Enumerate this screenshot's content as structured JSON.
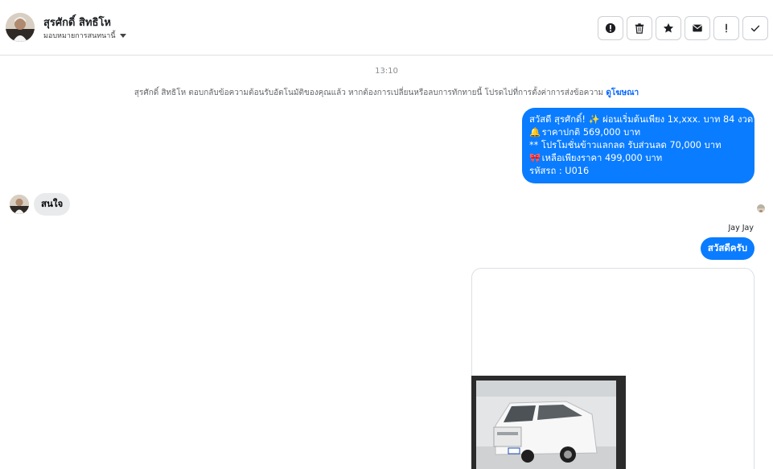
{
  "header": {
    "name": "สุรศักดิ์ สิทธิโห",
    "assign_label": "มอบหมายการสนทนานี้",
    "actions": [
      "alert-icon",
      "trash-icon",
      "star-icon",
      "envelope-icon",
      "exclamation-icon",
      "check-icon"
    ]
  },
  "conversation": {
    "timestamp": "13:10",
    "notice_text": "สุรศักดิ์ สิทธิโห ตอบกลับข้อความต้อนรับอัตโนมัติของคุณแล้ว หากต้องการเปลี่ยนหรือลบการทักทายนี้ โปรดไปที่การตั้งค่าการส่งข้อความ",
    "notice_link": "ดูโฆษณา",
    "outgoing_1": {
      "line1": "สวัสดี สุรศักดิ์! ✨  ผ่อนเริ่มต้นเพียง 1x,xxx. บาท 84 งวด",
      "line2_icon": "🔔",
      "line2": " ราคาปกติ 569,000 บาท",
      "line3": "** โปรโมชั่นข้าวแลกลด รับส่วนลด 70,000 บาท",
      "line4_icon": "🎀",
      "line4": "  เหลือเพียงราคา 499,000 บาท",
      "line5": " รหัสรถ : U016"
    },
    "incoming_1": "สนใจ",
    "sender_name": "Jay Jay",
    "outgoing_2": "สวัสดีครับ"
  },
  "colors": {
    "outgoing_bubble": "#0a7cff",
    "incoming_bubble": "#e9eaec",
    "link": "#0866ff"
  }
}
